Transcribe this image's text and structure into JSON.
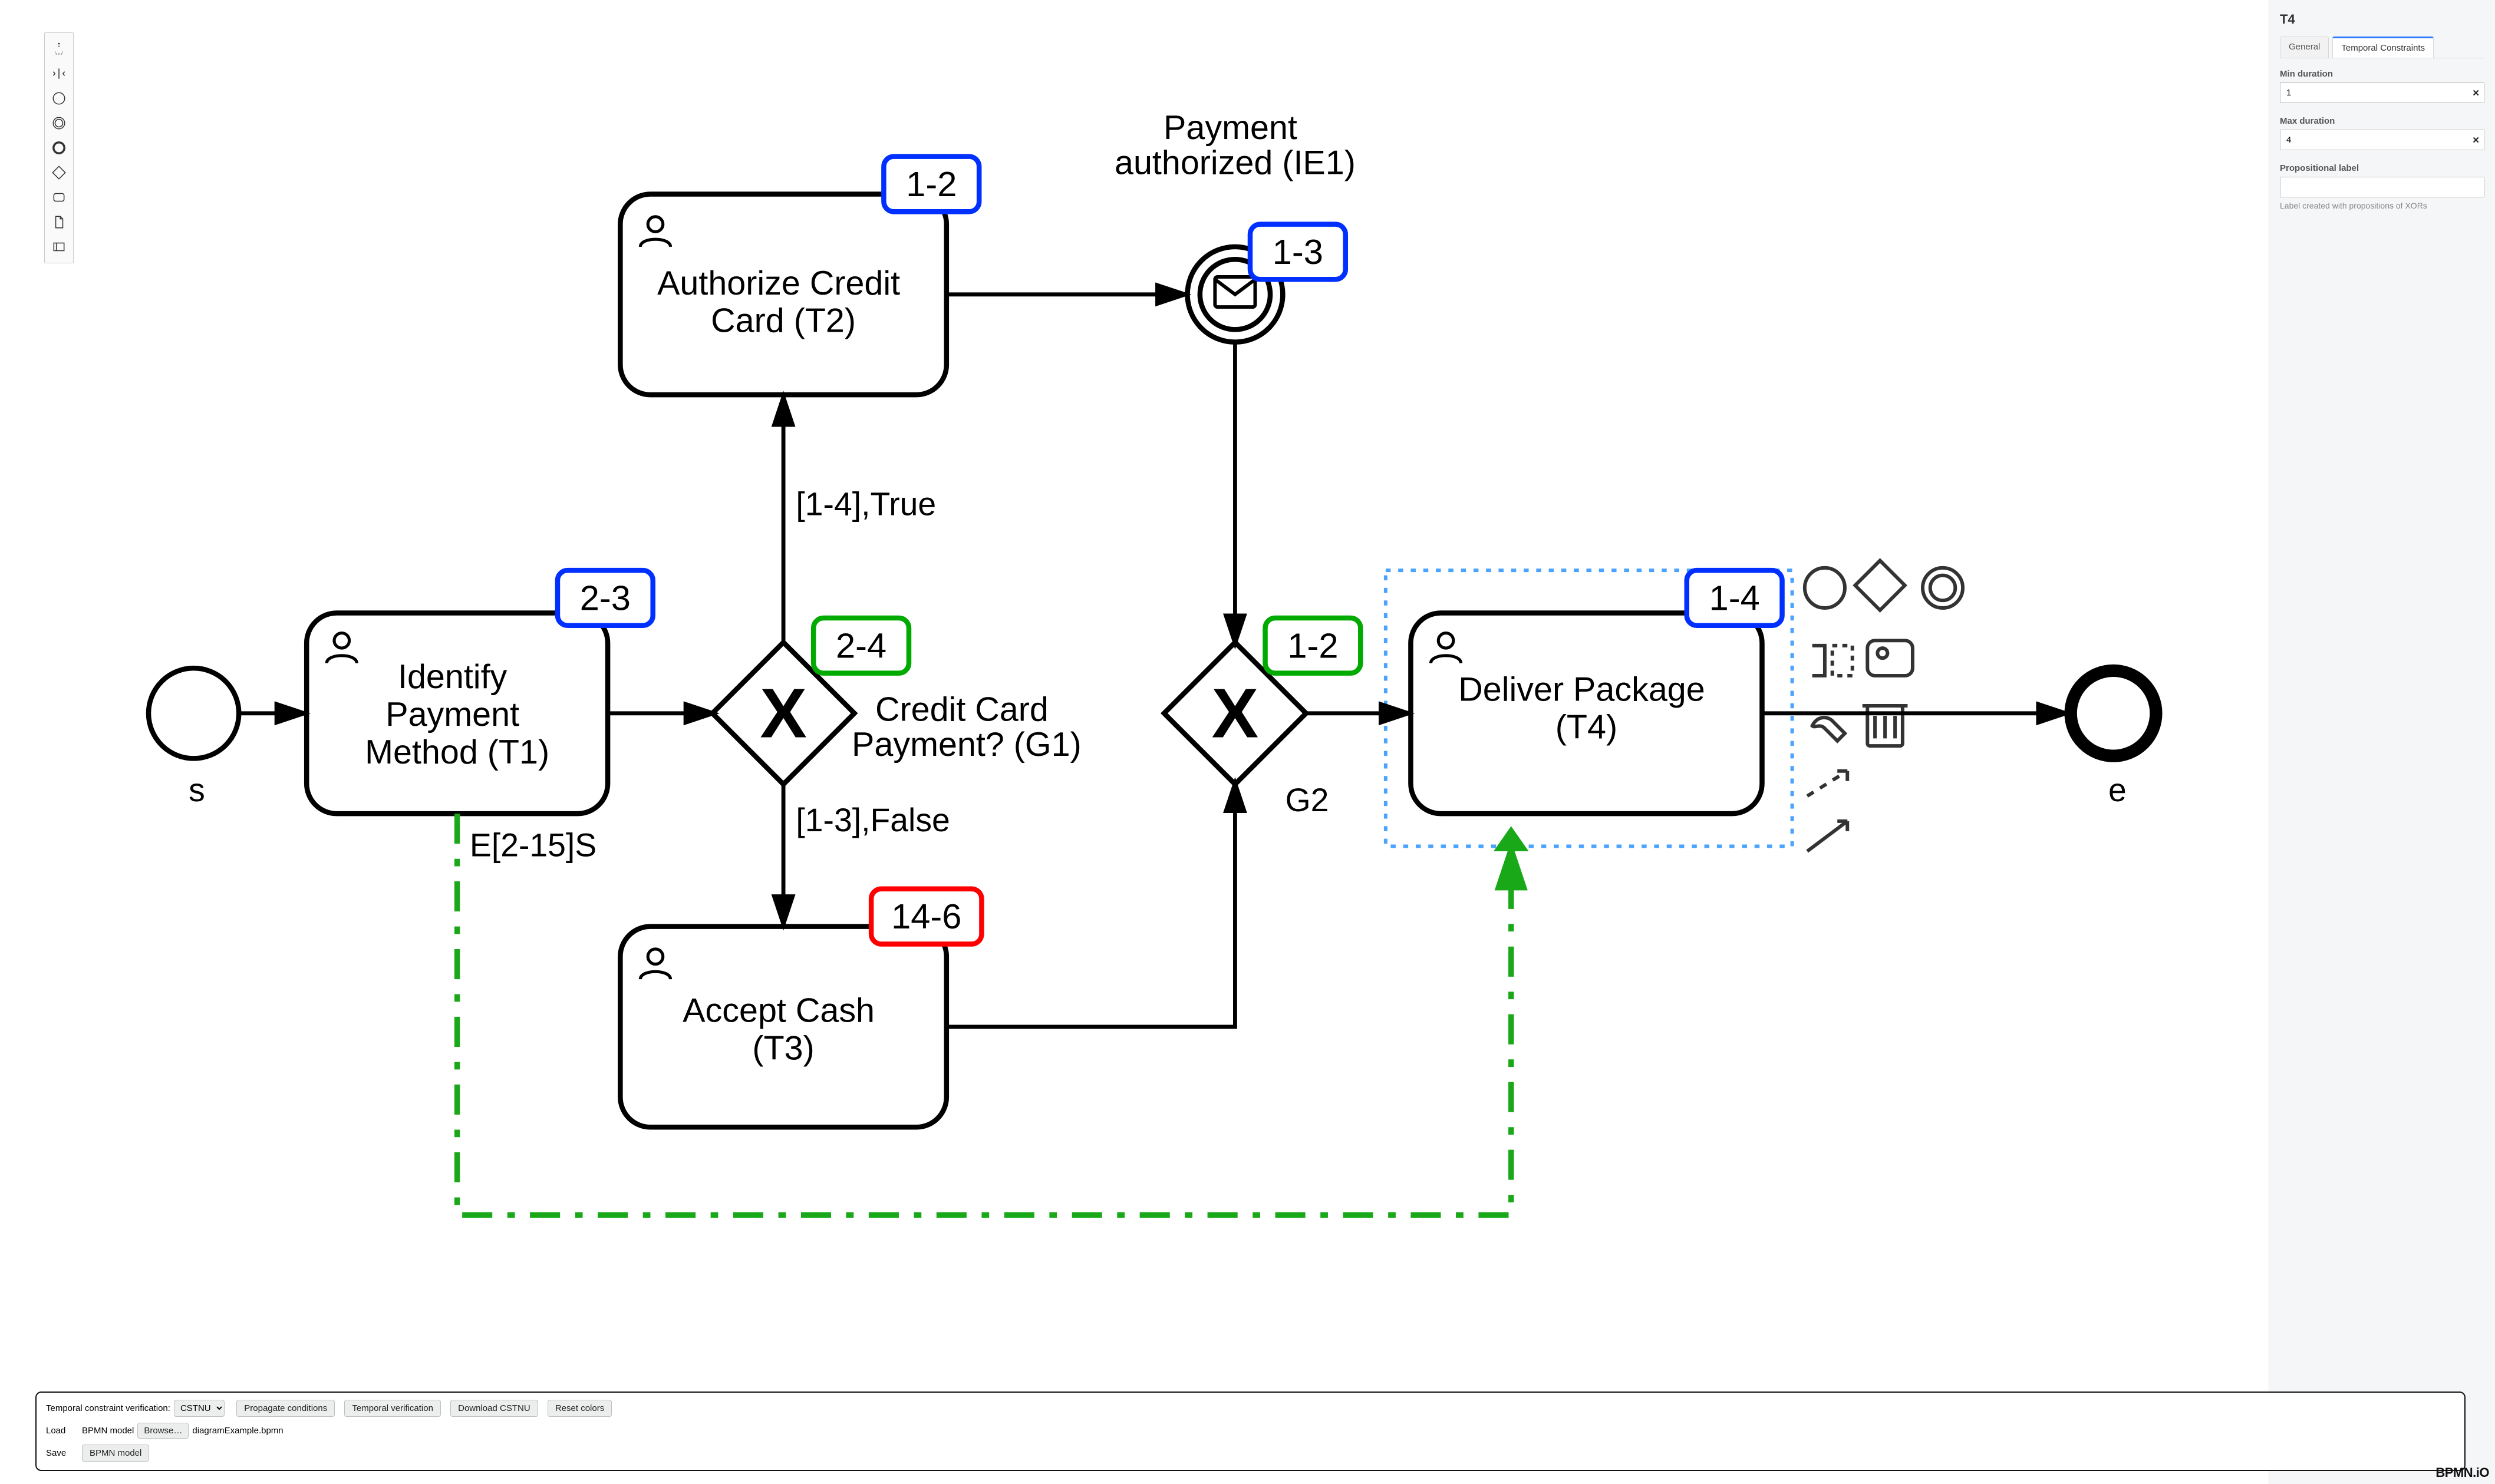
{
  "panelTitle": "T4",
  "tabs": {
    "general": "General",
    "temporal": "Temporal Constraints"
  },
  "fields": {
    "minDuration": {
      "label": "Min duration",
      "value": "1"
    },
    "maxDuration": {
      "label": "Max duration",
      "value": "4"
    },
    "propLabel": {
      "label": "Propositional label",
      "value": "",
      "hint": "Label created with propositions of XORs"
    }
  },
  "bottom": {
    "verificationLabel": "Temporal constraint verification:",
    "selectOptions": [
      "CSTNU"
    ],
    "selectValue": "CSTNU",
    "btnPropagate": "Propagate conditions",
    "btnVerify": "Temporal verification",
    "btnDownload": "Download CSTNU",
    "btnReset": "Reset colors",
    "loadLabel": "Load",
    "loadCaption": "BPMN model",
    "browse": "Browse…",
    "loadedFile": "diagramExample.bpmn",
    "saveLabel": "Save",
    "btnSave": "BPMN model"
  },
  "brand": "BPMN.iO",
  "diagram": {
    "startLabel": "s",
    "endLabel": "e",
    "tasks": {
      "t1": "Identify Payment Method (T1)",
      "t2": "Authorize Credit Card (T2)",
      "t3": "Accept Cash (T3)",
      "t4": "Deliver Package (T4)"
    },
    "gateways": {
      "g1": "Credit Card Payment? (G1)",
      "g2": "G2"
    },
    "intermediate": {
      "ie1": "Payment authorized (IE1)"
    },
    "edgeLabels": {
      "g1true": "[1-4],True",
      "g1false": "[1-3],False",
      "relativeES": "E[2-15]S"
    },
    "badges": {
      "t1": "2-3",
      "t2": "1-2",
      "t3": "14-6",
      "t4": "1-4",
      "g1": "2-4",
      "g2": "1-2",
      "ie1": "1-3"
    }
  }
}
